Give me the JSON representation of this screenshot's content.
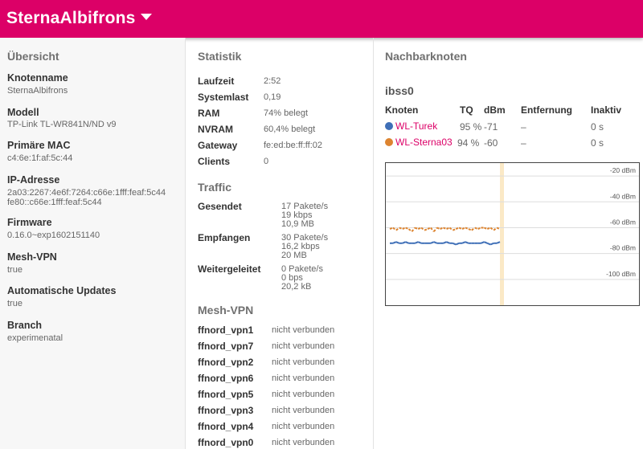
{
  "header": {
    "title": "SternaAlbifrons"
  },
  "overview": {
    "title": "Übersicht",
    "fields": [
      {
        "label": "Knotenname",
        "value": "SternaAlbifrons"
      },
      {
        "label": "Modell",
        "value": "TP-Link TL-WR841N/ND v9"
      },
      {
        "label": "Primäre MAC",
        "value": "c4:6e:1f:af:5c:44"
      },
      {
        "label": "IP-Adresse",
        "value": "2a03:2267:4e6f:7264:c66e:1fff:feaf:5c44\nfe80::c66e:1fff:feaf:5c44"
      },
      {
        "label": "Firmware",
        "value": "0.16.0~exp1602151140"
      },
      {
        "label": "Mesh-VPN",
        "value": "true"
      },
      {
        "label": "Automatische Updates",
        "value": "true"
      },
      {
        "label": "Branch",
        "value": "experimenatal"
      }
    ]
  },
  "stats": {
    "title": "Statistik",
    "rows": [
      {
        "label": "Laufzeit",
        "value": "2:52"
      },
      {
        "label": "Systemlast",
        "value": "0,19"
      },
      {
        "label": "RAM",
        "value": "74% belegt"
      },
      {
        "label": "NVRAM",
        "value": "60,4% belegt"
      },
      {
        "label": "Gateway",
        "value": "fe:ed:be:ff:ff:02"
      },
      {
        "label": "Clients",
        "value": "0"
      }
    ]
  },
  "traffic": {
    "title": "Traffic",
    "rows": [
      {
        "label": "Gesendet",
        "lines": [
          "17 Pakete/s",
          "19 kbps",
          "10,9 MB"
        ]
      },
      {
        "label": "Empfangen",
        "lines": [
          "30 Pakete/s",
          "16,2 kbps",
          "20 MB"
        ]
      },
      {
        "label": "Weitergeleitet",
        "lines": [
          "0 Pakete/s",
          "0 bps",
          "20,2 kB"
        ]
      }
    ]
  },
  "mesh_vpn": {
    "title": "Mesh-VPN",
    "peers": [
      {
        "name": "ffnord_vpn1",
        "status": "nicht verbunden"
      },
      {
        "name": "ffnord_vpn7",
        "status": "nicht verbunden"
      },
      {
        "name": "ffnord_vpn2",
        "status": "nicht verbunden"
      },
      {
        "name": "ffnord_vpn6",
        "status": "nicht verbunden"
      },
      {
        "name": "ffnord_vpn5",
        "status": "nicht verbunden"
      },
      {
        "name": "ffnord_vpn3",
        "status": "nicht verbunden"
      },
      {
        "name": "ffnord_vpn4",
        "status": "nicht verbunden"
      },
      {
        "name": "ffnord_vpn0",
        "status": "nicht verbunden"
      }
    ]
  },
  "neighbours": {
    "title": "Nachbarknoten",
    "interface": "ibss0",
    "columns": [
      "Knoten",
      "TQ",
      "dBm",
      "Entfernung",
      "Inaktiv"
    ],
    "rows": [
      {
        "name": "WL-Turek",
        "tq": "95 %",
        "dbm": "-71",
        "distance": "–",
        "inactive": "0 s",
        "color": "#3f6fb7"
      },
      {
        "name": "WL-Sterna03",
        "tq": "94 %",
        "dbm": "-60",
        "distance": "–",
        "inactive": "0 s",
        "color": "#dd8430"
      }
    ],
    "graph": {
      "y_labels": [
        "-20 dBm",
        "-40 dBm",
        "-60 dBm",
        "-80 dBm",
        "-100 dBm"
      ],
      "y_values": [
        -20,
        -40,
        -60,
        -80,
        -100
      ],
      "ylim": [
        -120,
        -10
      ],
      "series": [
        {
          "name": "WL-Turek",
          "color": "#3f6fb7",
          "values": [
            -72,
            -72,
            -71,
            -72,
            -72,
            -71,
            -72,
            -72,
            -72,
            -71,
            -72,
            -72,
            -72,
            -72,
            -71,
            -72,
            -72,
            -72,
            -71,
            -72,
            -72,
            -73,
            -72,
            -72,
            -71,
            -72,
            -72,
            -72,
            -72,
            -72,
            -71,
            -72,
            -73,
            -72,
            -72,
            -71
          ]
        },
        {
          "name": "WL-Sterna03",
          "color": "#dd8430",
          "values": [
            -61,
            -60,
            -62,
            -60,
            -61,
            -60,
            -61,
            -63,
            -60,
            -61,
            -60,
            -62,
            -61,
            -60,
            -63,
            -60,
            -61,
            -60,
            -61,
            -60,
            -62,
            -61,
            -60,
            -61,
            -60,
            -61,
            -62,
            -60,
            -61,
            -60,
            -60,
            -61,
            -60,
            -62,
            -60,
            -61
          ]
        }
      ]
    }
  }
}
